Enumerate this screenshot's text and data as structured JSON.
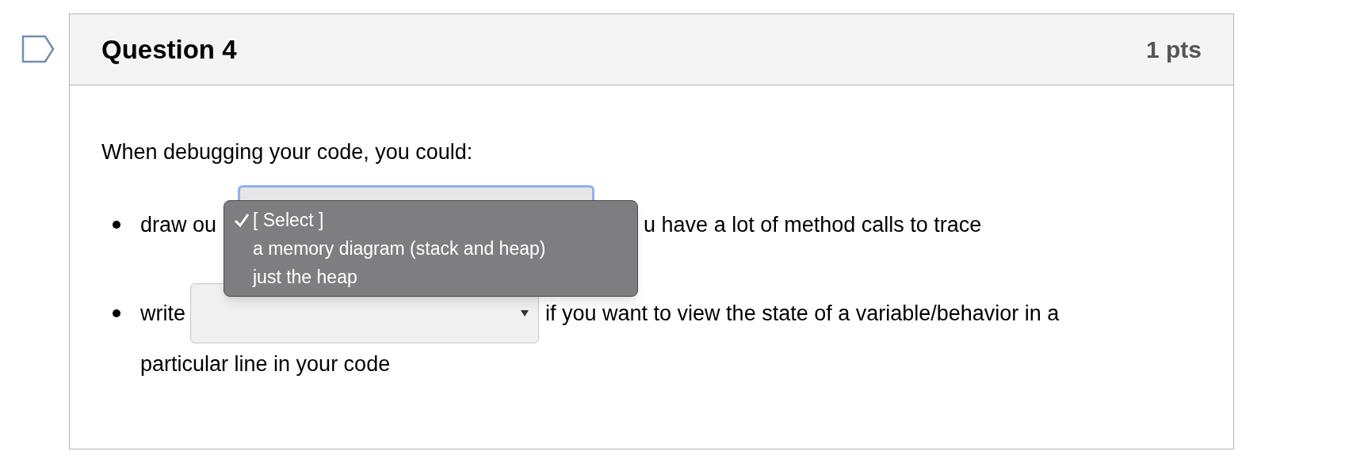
{
  "question": {
    "title": "Question 4",
    "points": "1 pts"
  },
  "prompt": "When debugging your code, you could:",
  "items": [
    {
      "kind": "open-select",
      "before": "draw ou",
      "after": "u have a lot of method calls to trace"
    },
    {
      "kind": "select",
      "before": "write",
      "after": "if you want to view the state of a variable/behavior in a",
      "continuation": "particular line in your code"
    }
  ],
  "menu": {
    "options": [
      {
        "label": "[ Select ]",
        "selected": true
      },
      {
        "label": "a memory diagram (stack and heap)",
        "selected": false
      },
      {
        "label": "just the heap",
        "selected": false
      }
    ]
  }
}
